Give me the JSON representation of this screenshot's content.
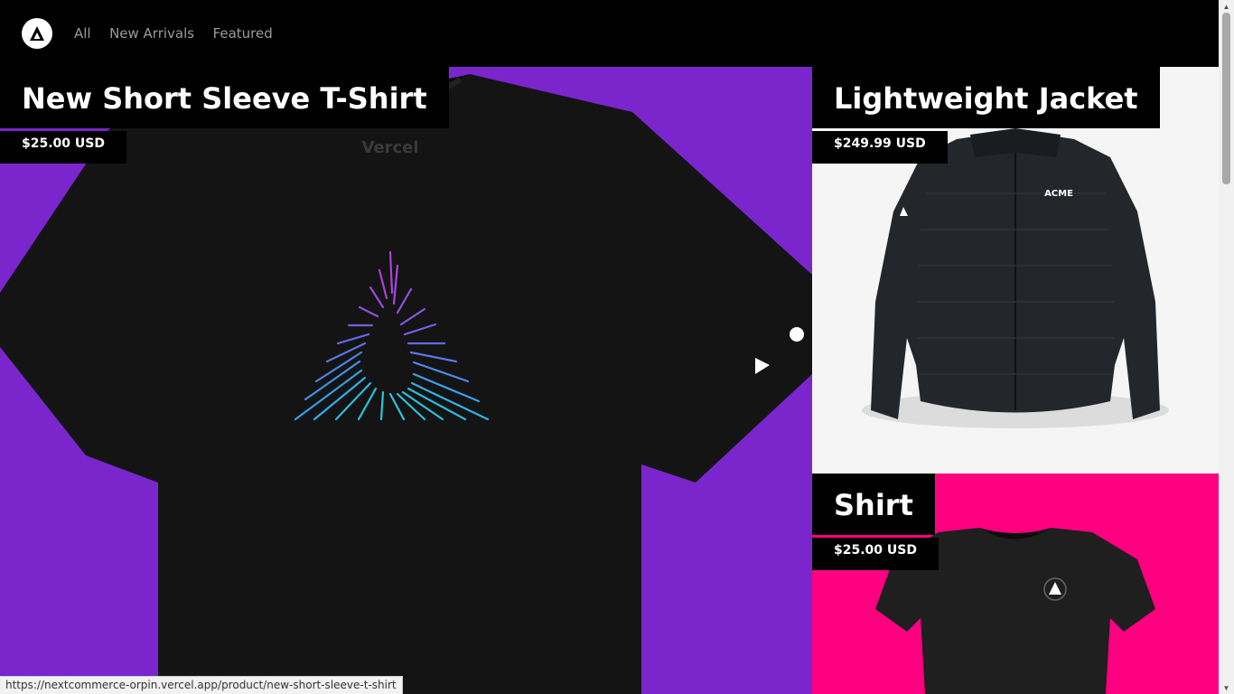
{
  "brand": {
    "logo_icon": "acme-triangle-logo"
  },
  "nav": {
    "items": [
      {
        "label": "All"
      },
      {
        "label": "New Arrivals"
      },
      {
        "label": "Featured"
      }
    ]
  },
  "products": {
    "main": {
      "title": "New Short Sleeve T-Shirt",
      "price": "$25.00 USD",
      "bg": "#7a26cc",
      "print": "Vercel"
    },
    "jacket": {
      "title": "Lightweight Jacket",
      "price": "$249.99 USD",
      "bg": "#f5f5f5",
      "print": "ACME"
    },
    "shirt": {
      "title": "Shirt",
      "price": "$25.00 USD",
      "bg": "#ff0080"
    }
  },
  "status_url": "https://nextcommerce-orpin.vercel.app/product/new-short-sleeve-t-shirt"
}
